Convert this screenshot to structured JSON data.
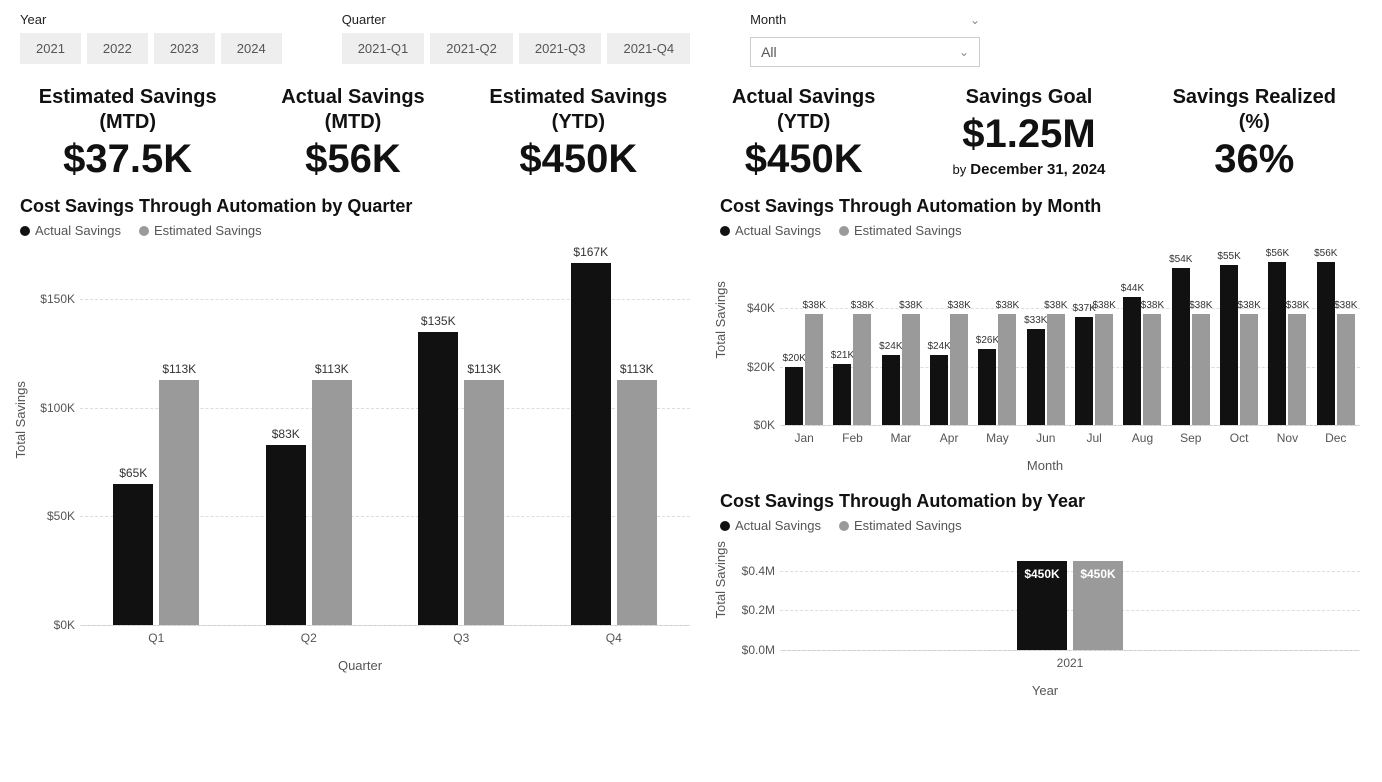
{
  "filters": {
    "year_label": "Year",
    "years": [
      "2021",
      "2022",
      "2023",
      "2024"
    ],
    "quarter_label": "Quarter",
    "quarters": [
      "2021-Q1",
      "2021-Q2",
      "2021-Q3",
      "2021-Q4"
    ],
    "month_label": "Month",
    "month_selected": "All"
  },
  "kpis": [
    {
      "title": "Estimated Savings (MTD)",
      "value": "$37.5K"
    },
    {
      "title": "Actual Savings (MTD)",
      "value": "$56K"
    },
    {
      "title": "Estimated Savings (YTD)",
      "value": "$450K"
    },
    {
      "title": "Actual Savings (YTD)",
      "value": "$450K"
    },
    {
      "title": "Savings Goal",
      "value": "$1.25M",
      "sub_by": "by",
      "sub": "December 31, 2024"
    },
    {
      "title": "Savings Realized (%)",
      "value": "36%"
    }
  ],
  "legend": {
    "actual": "Actual Savings",
    "estimated": "Estimated Savings"
  },
  "chart_data": [
    {
      "id": "quarter",
      "type": "bar",
      "title": "Cost Savings Through Automation by Quarter",
      "xlabel": "Quarter",
      "ylabel": "Total Savings",
      "ylim": [
        0,
        170
      ],
      "yticks": [
        {
          "v": 0,
          "t": "$0K"
        },
        {
          "v": 50,
          "t": "$50K"
        },
        {
          "v": 100,
          "t": "$100K"
        },
        {
          "v": 150,
          "t": "$150K"
        }
      ],
      "categories": [
        "Q1",
        "Q2",
        "Q3",
        "Q4"
      ],
      "series": [
        {
          "name": "Actual Savings",
          "color": "black",
          "values": [
            65,
            83,
            135,
            167
          ],
          "labels": [
            "$65K",
            "$83K",
            "$135K",
            "$167K"
          ]
        },
        {
          "name": "Estimated Savings",
          "color": "gray",
          "values": [
            113,
            113,
            113,
            113
          ],
          "labels": [
            "$113K",
            "$113K",
            "$113K",
            "$113K"
          ]
        }
      ]
    },
    {
      "id": "month",
      "type": "bar",
      "title": "Cost Savings Through Automation by Month",
      "xlabel": "Month",
      "ylabel": "Total Savings",
      "ylim": [
        0,
        58
      ],
      "yticks": [
        {
          "v": 0,
          "t": "$0K"
        },
        {
          "v": 20,
          "t": "$20K"
        },
        {
          "v": 40,
          "t": "$40K"
        }
      ],
      "categories": [
        "Jan",
        "Feb",
        "Mar",
        "Apr",
        "May",
        "Jun",
        "Jul",
        "Aug",
        "Sep",
        "Oct",
        "Nov",
        "Dec"
      ],
      "series": [
        {
          "name": "Actual Savings",
          "color": "black",
          "values": [
            20,
            21,
            24,
            24,
            26,
            33,
            37,
            44,
            54,
            55,
            56,
            56
          ],
          "labels": [
            "$20K",
            "$21K",
            "$24K",
            "$24K",
            "$26K",
            "$33K",
            "$37K",
            "$44K",
            "$54K",
            "$55K",
            "$56K",
            "$56K"
          ]
        },
        {
          "name": "Estimated Savings",
          "color": "gray",
          "values": [
            38,
            38,
            38,
            38,
            38,
            38,
            38,
            38,
            38,
            38,
            38,
            38
          ],
          "labels": [
            "$38K",
            "$38K",
            "$38K",
            "$38K",
            "$38K",
            "$38K",
            "$38K",
            "$38K",
            "$38K",
            "$38K",
            "$38K",
            "$38K"
          ]
        }
      ]
    },
    {
      "id": "year",
      "type": "bar",
      "title": "Cost Savings Through Automation by Year",
      "xlabel": "Year",
      "ylabel": "Total Savings",
      "ylim": [
        0,
        0.5
      ],
      "yticks": [
        {
          "v": 0,
          "t": "$0.0M"
        },
        {
          "v": 0.2,
          "t": "$0.2M"
        },
        {
          "v": 0.4,
          "t": "$0.4M"
        }
      ],
      "categories": [
        "2021"
      ],
      "series": [
        {
          "name": "Actual Savings",
          "color": "black",
          "values": [
            0.45
          ],
          "labels": [
            "$450K"
          ]
        },
        {
          "name": "Estimated Savings",
          "color": "gray",
          "values": [
            0.45
          ],
          "labels": [
            "$450K"
          ]
        }
      ]
    }
  ]
}
